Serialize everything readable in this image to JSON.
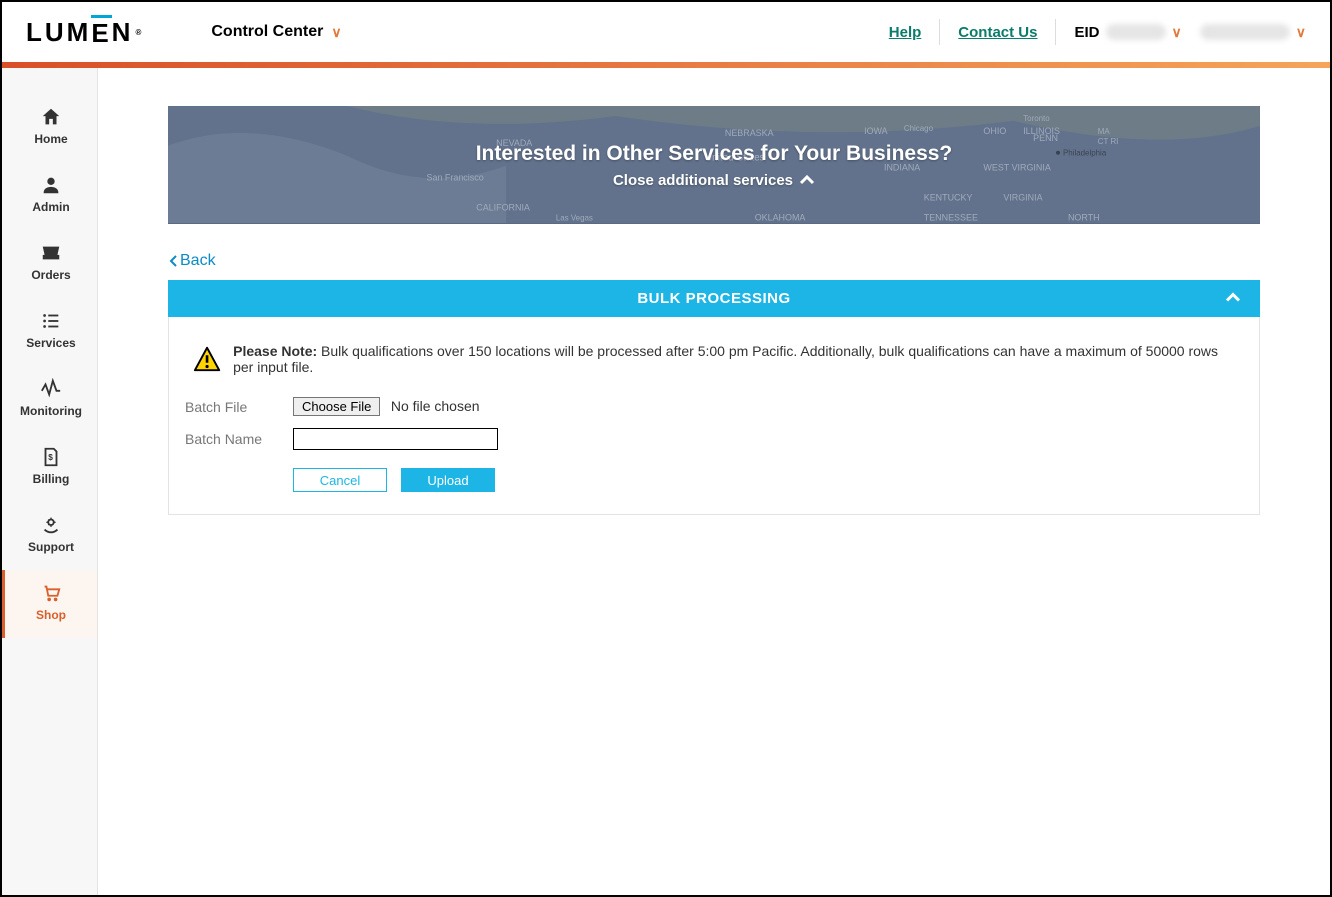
{
  "header": {
    "logo_text": "LUMEN",
    "control_center": "Control Center",
    "help": "Help",
    "contact": "Contact Us",
    "eid_label": "EID"
  },
  "sidebar": {
    "items": [
      {
        "label": "Home"
      },
      {
        "label": "Admin"
      },
      {
        "label": "Orders"
      },
      {
        "label": "Services"
      },
      {
        "label": "Monitoring"
      },
      {
        "label": "Billing"
      },
      {
        "label": "Support"
      },
      {
        "label": "Shop"
      }
    ]
  },
  "banner": {
    "title": "Interested in Other Services for Your Business?",
    "close": "Close additional services"
  },
  "back": "Back",
  "panel": {
    "title": "BULK PROCESSING",
    "note_label": "Please Note:",
    "note_text": "Bulk qualifications over 150 locations will be processed after 5:00 pm Pacific. Additionally, bulk qualifications can have a maximum of 50000 rows per input file.",
    "batch_file_label": "Batch File",
    "choose_file": "Choose File",
    "file_status": "No file chosen",
    "batch_name_label": "Batch Name",
    "batch_name_value": "",
    "cancel": "Cancel",
    "upload": "Upload"
  }
}
